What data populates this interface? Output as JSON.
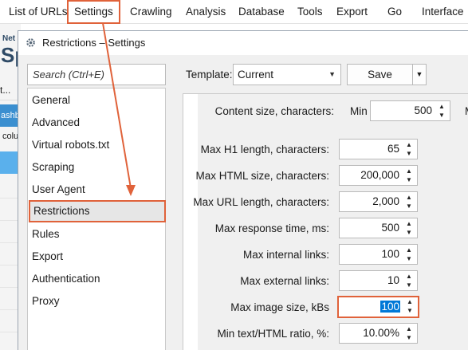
{
  "menubar": {
    "items": [
      "List of URLs",
      "Settings",
      "Crawling",
      "Analysis",
      "Database",
      "Tools",
      "Export",
      "Go",
      "Interface"
    ],
    "highlighted_index": 1
  },
  "background_app": {
    "logo_small": "Net",
    "logo_large": "Sp",
    "text_t": "t...",
    "tab_label": "ashb",
    "col_label": "colu"
  },
  "dialog": {
    "title": "Restrictions – Settings",
    "search_placeholder": "Search (Ctrl+E)",
    "nav_items": [
      "General",
      "Advanced",
      "Virtual robots.txt",
      "Scraping",
      "User Agent",
      "Restrictions",
      "Rules",
      "Export",
      "Authentication",
      "Proxy"
    ],
    "active_nav_index": 5,
    "template_label": "Template:",
    "template_value": "Current",
    "save_label": "Save",
    "content_size": {
      "label": "Content size, characters:",
      "min_label": "Min",
      "min_value": "500",
      "extra_label": "M"
    },
    "settings": [
      {
        "label": "Max H1 length, characters:",
        "value": "65"
      },
      {
        "label": "Max HTML size, characters:",
        "value": "200,000"
      },
      {
        "label": "Max URL length, characters:",
        "value": "2,000"
      },
      {
        "label": "Max response time, ms:",
        "value": "500"
      },
      {
        "label": "Max internal links:",
        "value": "100"
      },
      {
        "label": "Max external links:",
        "value": "10"
      },
      {
        "label": "Max image size, kBs",
        "value": "100"
      },
      {
        "label": "Min text/HTML ratio, %:",
        "value": "10.00%"
      }
    ],
    "focused_setting_index": 6
  },
  "colors": {
    "highlight": "#e0623a",
    "selection": "#0078d7",
    "accent_tab": "#3b8fd0"
  }
}
